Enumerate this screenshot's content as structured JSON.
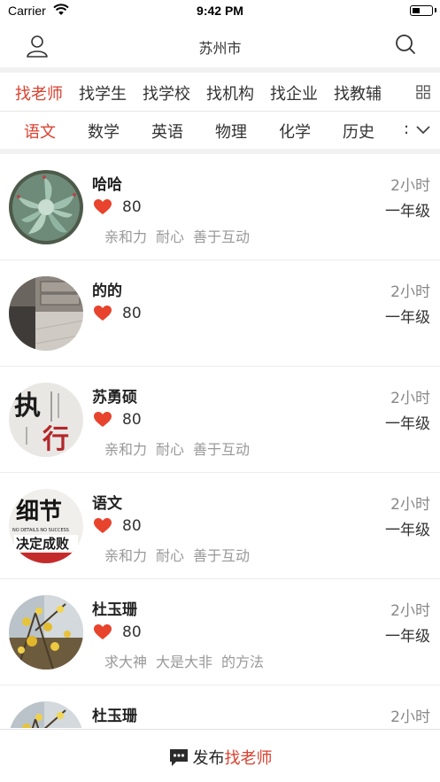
{
  "status_bar": {
    "carrier": "Carrier",
    "time": "9:42 PM"
  },
  "nav": {
    "title": "苏州市",
    "user_icon": "user-icon",
    "search_icon": "search-icon"
  },
  "category_tabs": [
    {
      "label": "找老师",
      "active": true
    },
    {
      "label": "找学生",
      "active": false
    },
    {
      "label": "找学校",
      "active": false
    },
    {
      "label": "找机构",
      "active": false
    },
    {
      "label": "找企业",
      "active": false
    },
    {
      "label": "找教辅",
      "active": false
    }
  ],
  "subject_tabs": [
    {
      "label": "语文",
      "active": true
    },
    {
      "label": "数学",
      "active": false
    },
    {
      "label": "英语",
      "active": false
    },
    {
      "label": "物理",
      "active": false
    },
    {
      "label": "化学",
      "active": false
    },
    {
      "label": "历史",
      "active": false
    }
  ],
  "subject_more": ":",
  "teachers": [
    {
      "name": "哈哈",
      "time": "2小时",
      "likes": "80",
      "grade": "一年级",
      "tags": [
        "亲和力",
        "耐心",
        "善于互动"
      ]
    },
    {
      "name": "的的",
      "time": "2小时",
      "likes": "80",
      "grade": "一年级",
      "tags": []
    },
    {
      "name": "苏勇硕",
      "time": "2小时",
      "likes": "80",
      "grade": "一年级",
      "tags": [
        "亲和力",
        "耐心",
        "善于互动"
      ]
    },
    {
      "name": "语文",
      "time": "2小时",
      "likes": "80",
      "grade": "一年级",
      "tags": [
        "亲和力",
        "耐心",
        "善于互动"
      ]
    },
    {
      "name": "杜玉珊",
      "time": "2小时",
      "likes": "80",
      "grade": "一年级",
      "tags": [
        "求大神",
        "大是大非",
        "的方法"
      ]
    },
    {
      "name": "杜玉珊",
      "time": "2小时",
      "likes": "",
      "grade": "",
      "tags": []
    }
  ],
  "avatars": {
    "a3_text_top": "执",
    "a3_text_bottom": "行",
    "a4_text_top": "细节",
    "a4_text_mid": "NO DETAILS NO SUCCESS",
    "a4_text_bottom": "决定成败"
  },
  "bottom": {
    "label_prefix": "发布",
    "label_accent": "找老师"
  },
  "colors": {
    "accent": "#d9412f",
    "heart": "#e8432d"
  }
}
